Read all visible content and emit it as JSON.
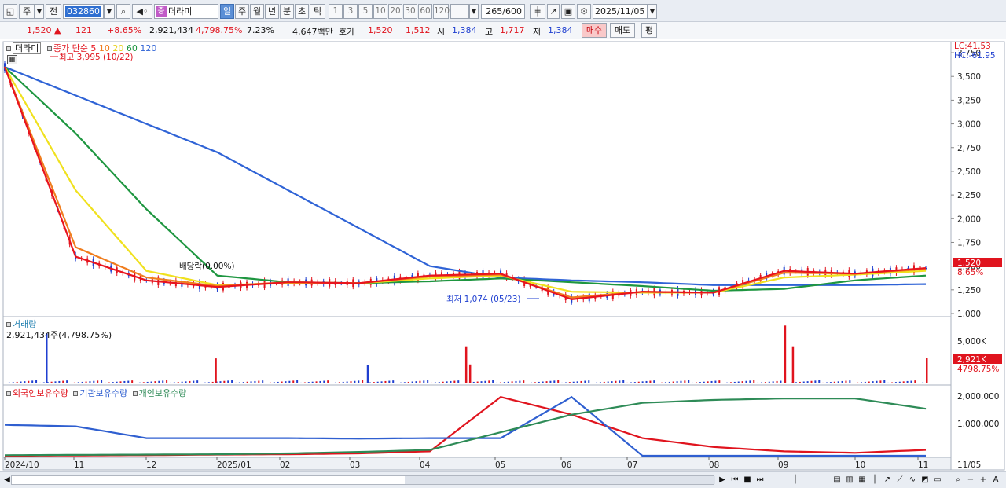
{
  "toolbar": {
    "type_label": "주",
    "type2_label": "전",
    "code": "032860",
    "stock_badge": "증",
    "stock_name": "더라미",
    "periods": [
      "일",
      "주",
      "월",
      "년",
      "분",
      "초",
      "틱"
    ],
    "numbers": [
      "1",
      "3",
      "5",
      "10",
      "20",
      "30",
      "60",
      "120"
    ],
    "count": "265",
    "count_total": "/600",
    "date": "2025/11/05"
  },
  "quote": {
    "price": "1,520",
    "change": "121",
    "change_pct": "+8.65%",
    "volume": "2,921,434",
    "volume_pct": "4,798.75%",
    "turnover": "7.23%",
    "amount": "4,647백만",
    "hoga_label": "호가",
    "ask": "1,520",
    "bid": "1,512",
    "open_label": "시",
    "open": "1,384",
    "high_label": "고",
    "high": "1,717",
    "low_label": "저",
    "low": "1,384",
    "buy_label": "매수",
    "sell_label": "매도",
    "eval_label": "평"
  },
  "price_panel": {
    "name_tag": "더라미",
    "ma_title": "종가 단순",
    "ma_periods": [
      "5",
      "10",
      "20",
      "60",
      "120"
    ],
    "ma_colors": [
      "#e8141e",
      "#f07d1e",
      "#f0e11e",
      "#1e9640",
      "#2f63d6"
    ],
    "high_note": "최고 3,995 (10/22)",
    "low_note": "최저 1,074 (05/23)",
    "dividend_note": "배당락(0.00%)",
    "lc": "LC:41.53",
    "hc": "HC:-61.95",
    "current_tag": "1,520",
    "current_pct": "8.65%",
    "y_ticks": [
      "3,750",
      "3,500",
      "3,250",
      "3,000",
      "2,750",
      "2,500",
      "2,250",
      "2,000",
      "1,750",
      "1,500",
      "1,250",
      "1,000"
    ]
  },
  "volume_panel": {
    "title": "거래량",
    "value_label": "2,921,434주(4,798.75%)",
    "y_tick": "5,000K",
    "current_tag": "2,921K",
    "current_pct": "4798.75%"
  },
  "holdings_panel": {
    "legend": [
      "외국인보유수량",
      "기관보유수량",
      "개인보유수량"
    ],
    "legend_colors": [
      "#e0141e",
      "#2f5fd0",
      "#2e8b57"
    ],
    "y_ticks": [
      "2,000,000",
      "1,000,000"
    ]
  },
  "x_axis": [
    "2024/10",
    "11",
    "12",
    "2025/01",
    "02",
    "03",
    "04",
    "05",
    "06",
    "07",
    "08",
    "09",
    "10",
    "11",
    "11/05"
  ],
  "chart_data": {
    "type": "line",
    "title": "",
    "x": [
      "2024/10",
      "11",
      "12",
      "2025/01",
      "02",
      "03",
      "04",
      "05",
      "06",
      "07",
      "08",
      "09",
      "10",
      "11"
    ],
    "series": [
      {
        "name": "5",
        "values": [
          3600,
          1600,
          1350,
          1280,
          1330,
          1320,
          1400,
          1420,
          1150,
          1230,
          1220,
          1450,
          1420,
          1480
        ]
      },
      {
        "name": "10",
        "values": [
          3600,
          1700,
          1380,
          1290,
          1330,
          1320,
          1390,
          1410,
          1170,
          1230,
          1220,
          1430,
          1420,
          1470
        ]
      },
      {
        "name": "20",
        "values": [
          3600,
          2300,
          1450,
          1300,
          1320,
          1320,
          1370,
          1400,
          1230,
          1220,
          1220,
          1380,
          1410,
          1450
        ]
      },
      {
        "name": "60",
        "values": [
          3600,
          2900,
          2100,
          1400,
          1330,
          1320,
          1340,
          1370,
          1330,
          1290,
          1240,
          1260,
          1350,
          1400
        ]
      },
      {
        "name": "120",
        "values": [
          3600,
          3300,
          3000,
          2700,
          2300,
          1900,
          1500,
          1380,
          1350,
          1330,
          1300,
          1300,
          1300,
          1310
        ]
      }
    ],
    "ylim": [
      1000,
      3800
    ],
    "volume": {
      "spikes": [
        {
          "x": "2024/10",
          "value": 5800
        },
        {
          "x": "12",
          "value": 2900
        },
        {
          "x": "03",
          "value": 2100
        },
        {
          "x": "04",
          "value": 2200
        },
        {
          "x": "04",
          "value": 4300
        },
        {
          "x": "09",
          "value": 6700
        },
        {
          "x": "09",
          "value": 4300
        },
        {
          "x": "11",
          "value": 2921
        }
      ],
      "ylabel_unit": "K"
    },
    "holdings": {
      "series": [
        {
          "name": "외국인보유수량",
          "values": [
            0,
            10000,
            20000,
            40000,
            50000,
            80000,
            150000,
            2000000,
            1400000,
            600000,
            300000,
            150000,
            100000,
            200000
          ]
        },
        {
          "name": "기관보유수량",
          "values": [
            1050000,
            1000000,
            600000,
            600000,
            600000,
            580000,
            600000,
            600000,
            2000000,
            0,
            0,
            0,
            0,
            0
          ]
        },
        {
          "name": "개인보유수량",
          "values": [
            20000,
            30000,
            40000,
            50000,
            80000,
            130000,
            200000,
            800000,
            1400000,
            1800000,
            1900000,
            1950000,
            1950000,
            1600000
          ]
        }
      ],
      "ylim": [
        0,
        2300000
      ]
    },
    "grid": false,
    "legend": "top-left"
  }
}
